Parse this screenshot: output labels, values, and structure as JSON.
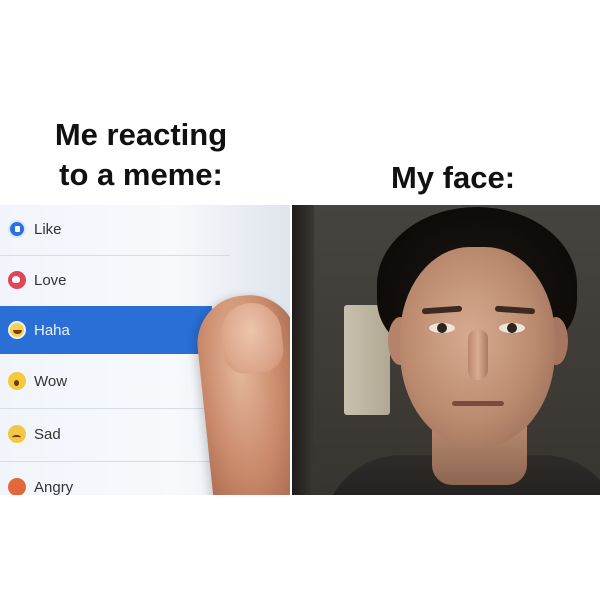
{
  "captions": {
    "left": "Me reacting\nto a meme:",
    "right": "My face:"
  },
  "reaction_menu": {
    "items": [
      {
        "label": "Like",
        "icon": "like-icon",
        "selected": false
      },
      {
        "label": "Love",
        "icon": "love-icon",
        "selected": false
      },
      {
        "label": "Haha",
        "icon": "haha-icon",
        "selected": true
      },
      {
        "label": "Wow",
        "icon": "wow-icon",
        "selected": false
      },
      {
        "label": "Sad",
        "icon": "sad-icon",
        "selected": false
      },
      {
        "label": "Angry",
        "icon": "angry-icon",
        "selected": false
      }
    ],
    "selected_color": "#2a6fd6"
  }
}
